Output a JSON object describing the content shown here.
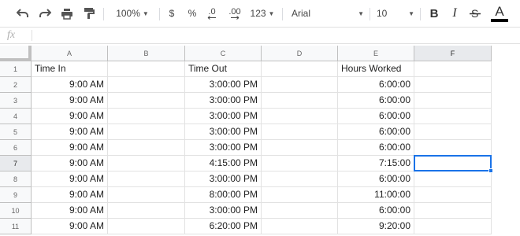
{
  "toolbar": {
    "zoom": "100%",
    "currency": "$",
    "percent": "%",
    "dec_decrease": ".0",
    "dec_increase": ".00",
    "more_formats": "123",
    "font": "Arial",
    "font_size": "10",
    "bold": "B",
    "italic": "I",
    "text_color": "A",
    "text_color_value": "#000000",
    "accent": "#1a73e8"
  },
  "formula_bar": {
    "fx_label": "fx",
    "value": ""
  },
  "columns": [
    "A",
    "B",
    "C",
    "D",
    "E",
    "F"
  ],
  "rows": [
    "1",
    "2",
    "3",
    "4",
    "5",
    "6",
    "7",
    "8",
    "9",
    "10",
    "11"
  ],
  "cells": {
    "A": [
      "Time In",
      "9:00 AM",
      "9:00 AM",
      "9:00 AM",
      "9:00 AM",
      "9:00 AM",
      "9:00 AM",
      "9:00 AM",
      "9:00 AM",
      "9:00 AM",
      "9:00 AM"
    ],
    "B": [
      "",
      "",
      "",
      "",
      "",
      "",
      "",
      "",
      "",
      "",
      ""
    ],
    "C": [
      "Time Out",
      "3:00:00 PM",
      "3:00:00 PM",
      "3:00:00 PM",
      "3:00:00 PM",
      "3:00:00 PM",
      "4:15:00 PM",
      "3:00:00 PM",
      "8:00:00 PM",
      "3:00:00 PM",
      "6:20:00 PM"
    ],
    "D": [
      "",
      "",
      "",
      "",
      "",
      "",
      "",
      "",
      "",
      "",
      ""
    ],
    "E": [
      "Hours Worked",
      "6:00:00",
      "6:00:00",
      "6:00:00",
      "6:00:00",
      "6:00:00",
      "7:15:00",
      "6:00:00",
      "11:00:00",
      "6:00:00",
      "9:20:00"
    ],
    "F": [
      "",
      "",
      "",
      "",
      "",
      "",
      "",
      "",
      "",
      "",
      ""
    ]
  },
  "selected_cell": {
    "column": "F",
    "row": "7"
  }
}
